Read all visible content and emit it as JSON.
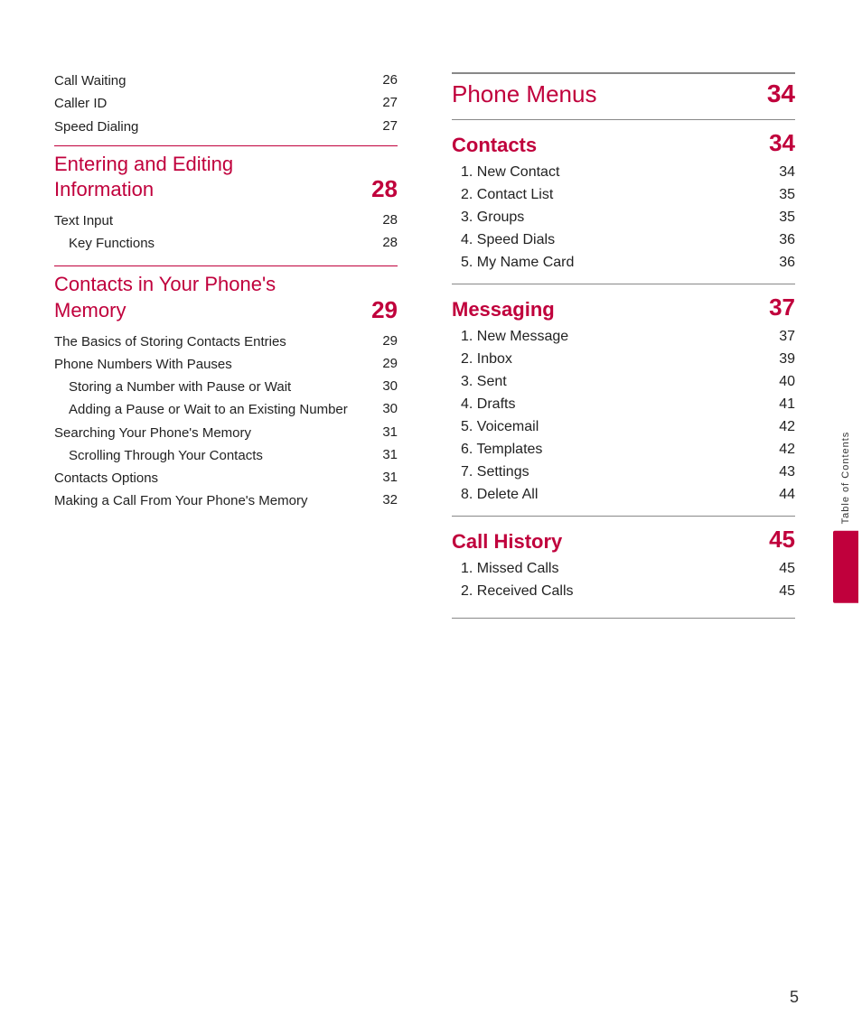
{
  "left": {
    "top_entries": [
      {
        "label": "Call Waiting",
        "number": "26"
      },
      {
        "label": "Caller ID",
        "number": "27"
      },
      {
        "label": "Speed Dialing",
        "number": "27"
      }
    ],
    "sections": [
      {
        "title": "Entering and Editing\nInformation",
        "number": "28",
        "entries": [
          {
            "label": "Text Input",
            "number": "28",
            "indent": false
          },
          {
            "label": "Key Functions",
            "number": "28",
            "indent": true
          }
        ]
      },
      {
        "title": "Contacts in Your Phone's\nMemory",
        "number": "29",
        "entries": [
          {
            "label": "The Basics of Storing Contacts Entries",
            "number": "29",
            "indent": false
          },
          {
            "label": "Phone Numbers With Pauses",
            "number": "29",
            "indent": false
          },
          {
            "label": "Storing a Number with Pause or Wait",
            "number": "30",
            "indent": true
          },
          {
            "label": "Adding a Pause or Wait to an Existing Number",
            "number": "30",
            "indent": true
          },
          {
            "label": "Searching Your Phone's Memory",
            "number": "31",
            "indent": false
          },
          {
            "label": "Scrolling Through Your Contacts",
            "number": "31",
            "indent": true
          },
          {
            "label": "Contacts Options",
            "number": "31",
            "indent": false
          },
          {
            "label": "Making a Call From Your Phone's Memory",
            "number": "32",
            "indent": false
          }
        ]
      }
    ]
  },
  "right": {
    "top_section": {
      "title": "Phone Menus",
      "number": "34"
    },
    "sections": [
      {
        "title": "Contacts",
        "number": "34",
        "entries": [
          {
            "label": "1.  New Contact",
            "number": "34"
          },
          {
            "label": "2.  Contact List",
            "number": "35"
          },
          {
            "label": "3.  Groups",
            "number": "35"
          },
          {
            "label": "4.  Speed Dials",
            "number": "36"
          },
          {
            "label": "5.  My Name Card",
            "number": "36"
          }
        ]
      },
      {
        "title": "Messaging",
        "number": "37",
        "entries": [
          {
            "label": "1.  New Message",
            "number": "37"
          },
          {
            "label": "2.  Inbox",
            "number": "39"
          },
          {
            "label": "3.  Sent",
            "number": "40"
          },
          {
            "label": "4.  Drafts",
            "number": "41"
          },
          {
            "label": "5.  Voicemail",
            "number": "42"
          },
          {
            "label": "6.  Templates",
            "number": "42"
          },
          {
            "label": "7.  Settings",
            "number": "43"
          },
          {
            "label": "8.  Delete All",
            "number": "44"
          }
        ]
      },
      {
        "title": "Call History",
        "number": "45",
        "entries": [
          {
            "label": "1.  Missed Calls",
            "number": "45"
          },
          {
            "label": "2.  Received Calls",
            "number": "45"
          }
        ]
      }
    ]
  },
  "side_tab": {
    "label": "Table of Contents"
  },
  "page_number": "5"
}
